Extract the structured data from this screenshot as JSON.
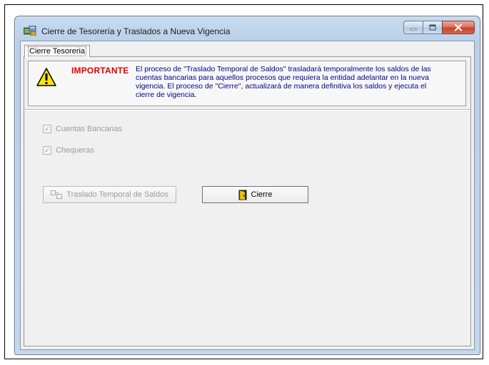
{
  "window": {
    "title": "Cierre de Tesorería  y Traslados a Nueva Vigencia",
    "icon": "treasury-app-icon",
    "controls": [
      "minimize",
      "maximize",
      "close"
    ]
  },
  "tabs": [
    {
      "label": "Cierre Tesoreria",
      "active": true
    }
  ],
  "notice": {
    "icon": "warning-icon",
    "title": "IMPORTANTE",
    "lines": [
      "El proceso de \"Traslado Temporal de Saldos\" trasladará temporalmente los saldos de las",
      "cuentas bancarias para aquellos procesos que requiera la entidad adelantar en la nueva",
      "vigencia. El proceso de \"Cierre\", actualizará de manera definitiva los saldos y ejecuta el",
      "cierre de vigencia."
    ]
  },
  "checkboxes": [
    {
      "label": "Cuentas Bancarias",
      "checked": true,
      "enabled": false
    },
    {
      "label": "Chequeras",
      "checked": true,
      "enabled": false
    }
  ],
  "buttons": {
    "traslado": {
      "label": "Traslado Temporal de Saldos",
      "enabled": false,
      "icon": "transfer-icon"
    },
    "cierre": {
      "label": "Cierre",
      "enabled": true,
      "icon": "door-exit-icon"
    }
  },
  "colors": {
    "notice_title": "#e00000",
    "notice_body": "#00008a",
    "disabled_text": "#9b9b9b"
  }
}
